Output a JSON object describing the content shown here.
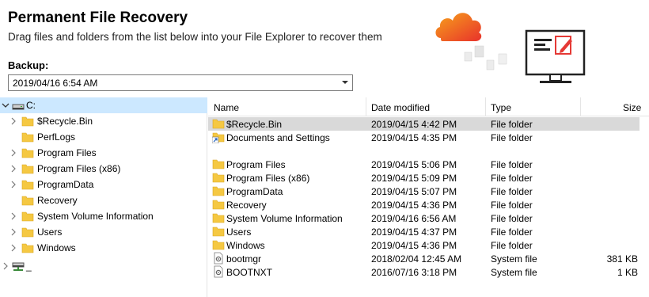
{
  "header": {
    "title": "Permanent File Recovery",
    "subtitle": "Drag files and folders from the list below into your File Explorer to recover them"
  },
  "backup": {
    "label": "Backup:",
    "selected": "2019/04/16 6:54 AM"
  },
  "tree": {
    "items": [
      {
        "label": "C:",
        "icon": "drive-icon",
        "expanded": true,
        "selected": true
      },
      {
        "label": "$Recycle.Bin",
        "icon": "folder-icon",
        "expandable": true
      },
      {
        "label": "PerfLogs",
        "icon": "folder-icon",
        "expandable": false
      },
      {
        "label": "Program Files",
        "icon": "folder-icon",
        "expandable": true
      },
      {
        "label": "Program Files (x86)",
        "icon": "folder-icon",
        "expandable": true
      },
      {
        "label": "ProgramData",
        "icon": "folder-icon",
        "expandable": true
      },
      {
        "label": "Recovery",
        "icon": "folder-icon",
        "expandable": false
      },
      {
        "label": "System Volume Information",
        "icon": "folder-icon",
        "expandable": true
      },
      {
        "label": "Users",
        "icon": "folder-icon",
        "expandable": true
      },
      {
        "label": "Windows",
        "icon": "folder-icon",
        "expandable": true
      },
      {
        "label": "_",
        "icon": "network-drive-icon",
        "expandable": true
      }
    ]
  },
  "list": {
    "columns": {
      "name": "Name",
      "date": "Date modified",
      "type": "Type",
      "size": "Size"
    },
    "rows": [
      {
        "name": "$Recycle.Bin",
        "date": "2019/04/15 4:42 PM",
        "type": "File folder",
        "size": "",
        "icon": "folder-icon",
        "highlighted": true
      },
      {
        "name": "Documents and Settings",
        "date": "2019/04/15 4:35 PM",
        "type": "File folder",
        "size": "",
        "icon": "shortcut-icon"
      },
      {
        "name": "Program Files",
        "date": "2019/04/15 5:06 PM",
        "type": "File folder",
        "size": "",
        "icon": "folder-icon"
      },
      {
        "name": "Program Files (x86)",
        "date": "2019/04/15 5:09 PM",
        "type": "File folder",
        "size": "",
        "icon": "folder-icon"
      },
      {
        "name": "ProgramData",
        "date": "2019/04/15 5:07 PM",
        "type": "File folder",
        "size": "",
        "icon": "folder-icon"
      },
      {
        "name": "Recovery",
        "date": "2019/04/15 4:36 PM",
        "type": "File folder",
        "size": "",
        "icon": "folder-icon"
      },
      {
        "name": "System Volume Information",
        "date": "2019/04/16 6:56 AM",
        "type": "File folder",
        "size": "",
        "icon": "folder-icon"
      },
      {
        "name": "Users",
        "date": "2019/04/15 4:37 PM",
        "type": "File folder",
        "size": "",
        "icon": "folder-icon"
      },
      {
        "name": "Windows",
        "date": "2019/04/15 4:36 PM",
        "type": "File folder",
        "size": "",
        "icon": "folder-icon"
      },
      {
        "name": "bootmgr",
        "date": "2018/02/04 12:45 AM",
        "type": "System file",
        "size": "381 KB",
        "icon": "system-file-icon"
      },
      {
        "name": "BOOTNXT",
        "date": "2016/07/16 3:18 PM",
        "type": "System file",
        "size": "1 KB",
        "icon": "system-file-icon"
      }
    ]
  },
  "colors": {
    "selection": "#cce8ff",
    "highlight_row": "#d9d9d9",
    "folder": "#f5c842",
    "accent_orange": "#f26522",
    "accent_red": "#e53935"
  }
}
